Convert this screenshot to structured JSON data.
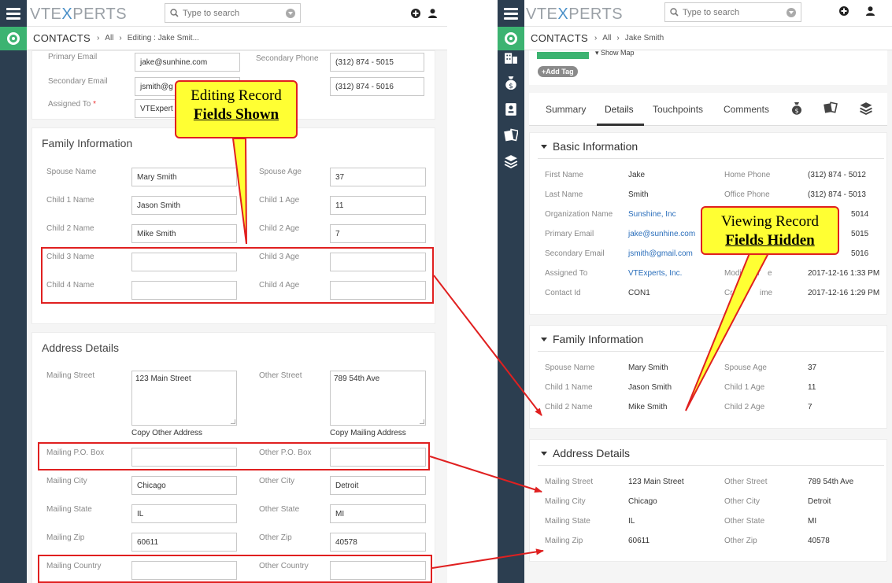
{
  "app": {
    "logo_prefix": "VTE",
    "logo_x": "X",
    "logo_suffix": "PERTS",
    "search_placeholder": "Type to search"
  },
  "left": {
    "breadcrumb": {
      "module": "CONTACTS",
      "all": "All",
      "current": "Editing : Jake Smit..."
    },
    "contact_fields": {
      "primary_email_label": "Primary Email",
      "primary_email_value": "jake@sunhine.com",
      "secondary_phone_label": "Secondary Phone",
      "secondary_phone_value": "(312) 874 - 5015",
      "secondary_email_label": "Secondary Email",
      "secondary_email_value": "jsmith@g",
      "other_phone_value": "(312) 874 - 5016",
      "assigned_to_label": "Assigned To",
      "required_mark": "*",
      "assigned_to_value": "VTExpert"
    },
    "family": {
      "title": "Family Information",
      "spouse_name_label": "Spouse Name",
      "spouse_name_value": "Mary Smith",
      "spouse_age_label": "Spouse Age",
      "spouse_age_value": "37",
      "child1_name_label": "Child 1 Name",
      "child1_name_value": "Jason Smith",
      "child1_age_label": "Child 1 Age",
      "child1_age_value": "11",
      "child2_name_label": "Child 2 Name",
      "child2_name_value": "Mike Smith",
      "child2_age_label": "Child 2 Age",
      "child2_age_value": "7",
      "child3_name_label": "Child 3 Name",
      "child3_age_label": "Child 3 Age",
      "child4_name_label": "Child 4 Name",
      "child4_age_label": "Child 4 Age"
    },
    "address": {
      "title": "Address Details",
      "mailing_street_label": "Mailing Street",
      "mailing_street_value": "123 Main Street",
      "other_street_label": "Other Street",
      "other_street_value": "789 54th Ave",
      "copy_other": "Copy Other Address",
      "copy_mailing": "Copy Mailing Address",
      "mailing_po_label": "Mailing P.O. Box",
      "other_po_label": "Other P.O. Box",
      "mailing_city_label": "Mailing City",
      "mailing_city_value": "Chicago",
      "other_city_label": "Other City",
      "other_city_value": "Detroit",
      "mailing_state_label": "Mailing State",
      "mailing_state_value": "IL",
      "other_state_label": "Other State",
      "other_state_value": "MI",
      "mailing_zip_label": "Mailing Zip",
      "mailing_zip_value": "60611",
      "other_zip_label": "Other Zip",
      "other_zip_value": "40578",
      "mailing_country_label": "Mailing Country",
      "other_country_label": "Other Country"
    }
  },
  "right": {
    "breadcrumb": {
      "module": "CONTACTS",
      "all": "All",
      "current": "Jake Smith"
    },
    "show_map": "Show Map",
    "add_tag": "Add Tag",
    "tabs": [
      "Summary",
      "Details",
      "Touchpoints",
      "Comments"
    ],
    "basic": {
      "title": "Basic Information",
      "rows": [
        {
          "l1": "First Name",
          "v1": "Jake",
          "l2": "Home Phone",
          "v2": "(312) 874 - 5012"
        },
        {
          "l1": "Last Name",
          "v1": "Smith",
          "l2": "Office Phone",
          "v2": "(312) 874 - 5013"
        },
        {
          "l1": "Organization Name",
          "v1": "Sunshine, Inc",
          "l2": "",
          "v2": "5014"
        },
        {
          "l1": "Primary Email",
          "v1": "jake@sunhine.com",
          "l2": "",
          "v2": "5015"
        },
        {
          "l1": "Secondary Email",
          "v1": "jsmith@gmail.com",
          "l2": "",
          "v2": "5016"
        },
        {
          "l1": "Assigned To",
          "v1": "VTExperts, Inc.",
          "l2": "Modified T",
          "l2b": "e",
          "v2": "2017-12-16 1:33 PM"
        },
        {
          "l1": "Contact Id",
          "v1": "CON1",
          "l2": "Create",
          "l2b": "ime",
          "v2": "2017-12-16 1:29 PM"
        }
      ]
    },
    "family": {
      "title": "Family Information",
      "rows": [
        {
          "l1": "Spouse Name",
          "v1": "Mary Smith",
          "l2": "Spouse Age",
          "v2": "37"
        },
        {
          "l1": "Child 1 Name",
          "v1": "Jason Smith",
          "l2": "Child 1 Age",
          "v2": "11"
        },
        {
          "l1": "Child 2 Name",
          "v1": "Mike Smith",
          "l2": "Child 2 Age",
          "v2": "7"
        }
      ]
    },
    "address": {
      "title": "Address Details",
      "rows": [
        {
          "l1": "Mailing Street",
          "v1": "123 Main Street",
          "l2": "Other Street",
          "v2": "789 54th Ave"
        },
        {
          "l1": "Mailing City",
          "v1": "Chicago",
          "l2": "Other City",
          "v2": "Detroit"
        },
        {
          "l1": "Mailing State",
          "v1": "IL",
          "l2": "Other State",
          "v2": "MI"
        },
        {
          "l1": "Mailing Zip",
          "v1": "60611",
          "l2": "Other Zip",
          "v2": "40578"
        }
      ]
    }
  },
  "callouts": {
    "editing_line1": "Editing Record",
    "editing_line2": "Fields Shown",
    "viewing_line1": "Viewing Record",
    "viewing_line2": "Fields Hidden"
  },
  "colors": {
    "rail": "#2c3e50",
    "accent_green": "#3cb371",
    "link_blue": "#2a6ebb",
    "annotation_red": "#e02020",
    "callout_yellow": "#ffff33"
  }
}
